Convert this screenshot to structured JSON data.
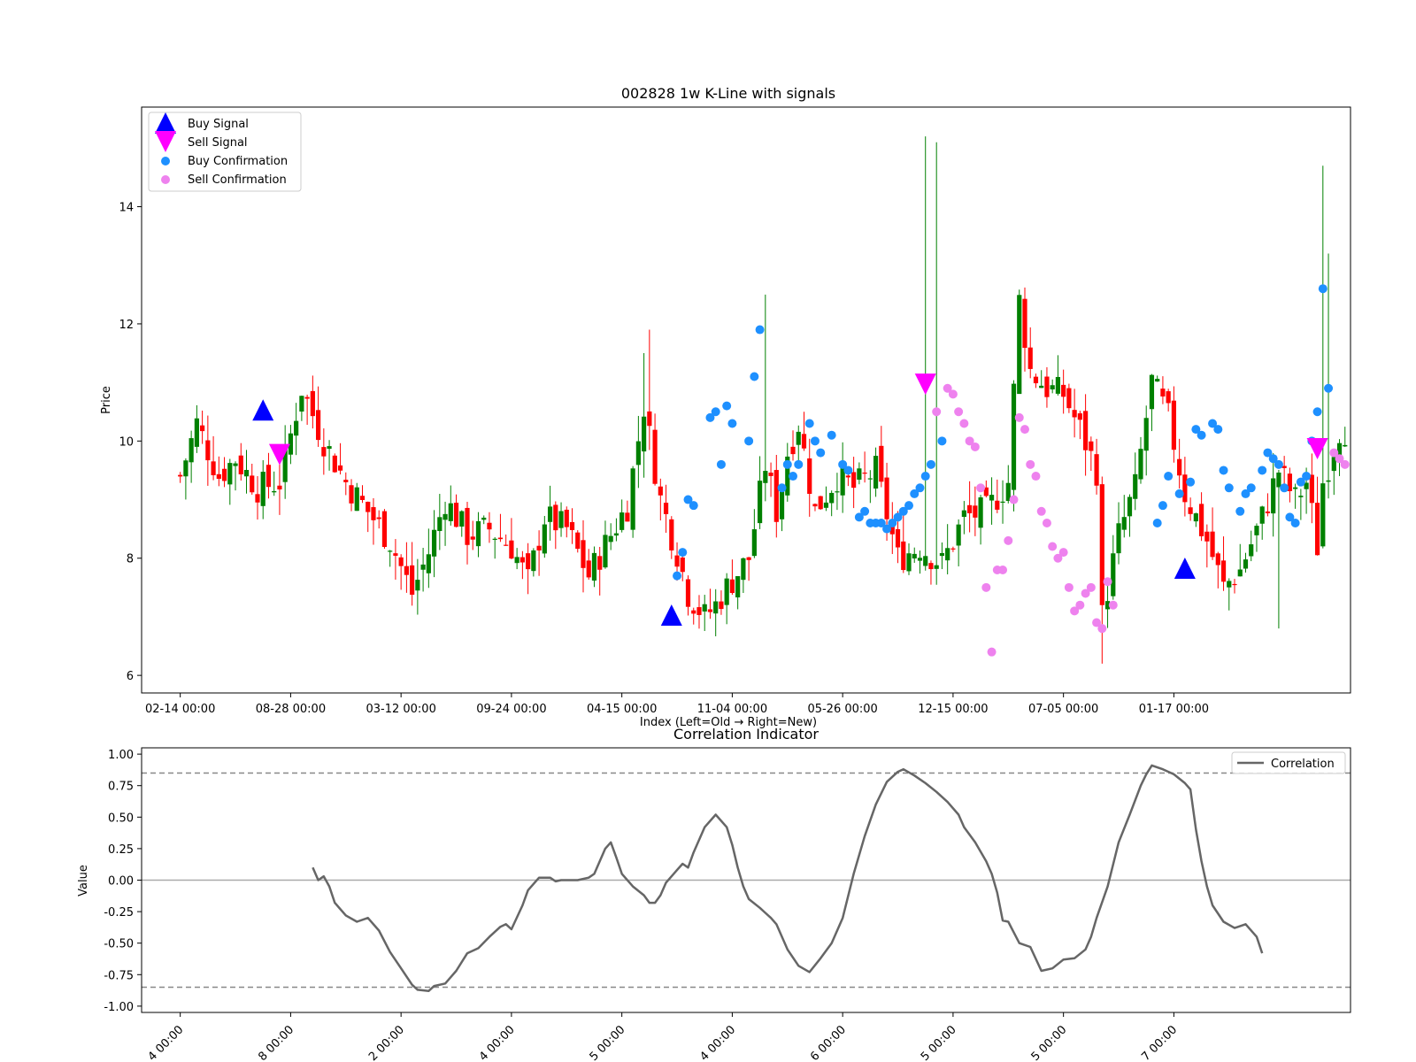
{
  "chart_data": [
    {
      "type": "candlestick",
      "title": "002828 1w K-Line with signals",
      "xlabel": "Index (Left=Old → Right=New)",
      "ylabel": "Price",
      "ylim": [
        5.7,
        15.7
      ],
      "xlim": [
        -7,
        212
      ],
      "yticks": [
        6,
        8,
        10,
        12,
        14
      ],
      "xticks": [
        {
          "i": 0,
          "label": "02-14 00:00"
        },
        {
          "i": 20,
          "label": "08-28 00:00"
        },
        {
          "i": 40,
          "label": "03-12 00:00"
        },
        {
          "i": 60,
          "label": "09-24 00:00"
        },
        {
          "i": 80,
          "label": "04-15 00:00"
        },
        {
          "i": 100,
          "label": "11-04 00:00"
        },
        {
          "i": 120,
          "label": "05-26 00:00"
        },
        {
          "i": 140,
          "label": "12-15 00:00"
        },
        {
          "i": 160,
          "label": "07-05 00:00"
        },
        {
          "i": 180,
          "label": "01-17 00:00"
        }
      ],
      "colors": {
        "up": "#008000",
        "down": "#ff0000",
        "buy_signal": "#0000ff",
        "sell_signal": "#ff00ff",
        "buy_confirmation": "#1e90ff",
        "sell_confirmation": "#ee82ee"
      },
      "legend": {
        "position": "top-left",
        "entries": [
          "Buy Signal",
          "Sell Signal",
          "Buy Confirmation",
          "Sell Confirmation"
        ]
      },
      "close_path": [
        [
          0,
          9.4
        ],
        [
          3,
          10.3
        ],
        [
          7,
          9.4
        ],
        [
          10,
          9.7
        ],
        [
          14,
          9.2
        ],
        [
          18,
          9.3
        ],
        [
          22,
          10.9
        ],
        [
          26,
          10.0
        ],
        [
          30,
          9.3
        ],
        [
          34,
          8.8
        ],
        [
          38,
          8.3
        ],
        [
          42,
          7.4
        ],
        [
          45,
          8.1
        ],
        [
          48,
          9.0
        ],
        [
          52,
          8.4
        ],
        [
          56,
          8.5
        ],
        [
          60,
          8.2
        ],
        [
          63,
          7.6
        ],
        [
          66,
          8.7
        ],
        [
          70,
          8.5
        ],
        [
          74,
          7.7
        ],
        [
          78,
          8.4
        ],
        [
          81,
          8.9
        ],
        [
          84,
          10.6
        ],
        [
          87,
          9.0
        ],
        [
          90,
          8.1
        ],
        [
          92,
          7.4
        ],
        [
          95,
          7.0
        ],
        [
          97,
          7.2
        ],
        [
          99,
          7.5
        ],
        [
          103,
          8.0
        ],
        [
          106,
          9.6
        ],
        [
          108,
          8.8
        ],
        [
          110,
          9.8
        ],
        [
          112,
          10.3
        ],
        [
          115,
          8.8
        ],
        [
          119,
          9.4
        ],
        [
          122,
          9.2
        ],
        [
          126,
          9.5
        ],
        [
          130,
          8.0
        ],
        [
          134,
          8.2
        ],
        [
          138,
          7.9
        ],
        [
          142,
          8.7
        ],
        [
          146,
          8.8
        ],
        [
          150,
          9.3
        ],
        [
          152,
          12.4
        ],
        [
          154,
          11.2
        ],
        [
          157,
          10.9
        ],
        [
          160,
          10.8
        ],
        [
          163,
          10.2
        ],
        [
          166,
          9.5
        ],
        [
          167,
          7.0
        ],
        [
          170,
          8.4
        ],
        [
          173,
          9.2
        ],
        [
          176,
          11.0
        ],
        [
          179,
          10.4
        ],
        [
          182,
          9.1
        ],
        [
          186,
          8.3
        ],
        [
          189,
          7.5
        ],
        [
          192,
          7.8
        ],
        [
          196,
          8.7
        ],
        [
          199,
          9.5
        ],
        [
          202,
          9.0
        ],
        [
          204,
          9.3
        ],
        [
          206,
          8.2
        ],
        [
          207,
          9.3
        ],
        [
          210,
          10.2
        ]
      ],
      "buy_signals": [
        [
          15,
          10.5
        ],
        [
          89,
          7.0
        ],
        [
          182,
          7.8
        ]
      ],
      "sell_signals": [
        [
          18,
          9.8
        ],
        [
          135,
          11.0
        ],
        [
          206,
          9.9
        ]
      ],
      "buy_confirmations": [
        [
          90,
          7.7
        ],
        [
          91,
          8.1
        ],
        [
          92,
          9.0
        ],
        [
          93,
          8.9
        ],
        [
          96,
          10.4
        ],
        [
          97,
          10.5
        ],
        [
          98,
          9.6
        ],
        [
          99,
          10.6
        ],
        [
          100,
          10.3
        ],
        [
          103,
          10.0
        ],
        [
          104,
          11.1
        ],
        [
          105,
          11.9
        ],
        [
          109,
          9.2
        ],
        [
          110,
          9.6
        ],
        [
          111,
          9.4
        ],
        [
          112,
          9.6
        ],
        [
          114,
          10.3
        ],
        [
          115,
          10.0
        ],
        [
          116,
          9.8
        ],
        [
          118,
          10.1
        ],
        [
          120,
          9.6
        ],
        [
          121,
          9.5
        ],
        [
          123,
          8.7
        ],
        [
          124,
          8.8
        ],
        [
          125,
          8.6
        ],
        [
          126,
          8.6
        ],
        [
          127,
          8.6
        ],
        [
          128,
          8.5
        ],
        [
          129,
          8.6
        ],
        [
          130,
          8.7
        ],
        [
          131,
          8.8
        ],
        [
          132,
          8.9
        ],
        [
          133,
          9.1
        ],
        [
          134,
          9.2
        ],
        [
          135,
          9.4
        ],
        [
          136,
          9.6
        ],
        [
          138,
          10.0
        ],
        [
          177,
          8.6
        ],
        [
          178,
          8.9
        ],
        [
          179,
          9.4
        ],
        [
          181,
          9.1
        ],
        [
          183,
          9.3
        ],
        [
          184,
          10.2
        ],
        [
          185,
          10.1
        ],
        [
          187,
          10.3
        ],
        [
          188,
          10.2
        ],
        [
          189,
          9.5
        ],
        [
          190,
          9.2
        ],
        [
          192,
          8.8
        ],
        [
          193,
          9.1
        ],
        [
          194,
          9.2
        ],
        [
          196,
          9.5
        ],
        [
          197,
          9.8
        ],
        [
          198,
          9.7
        ],
        [
          199,
          9.6
        ],
        [
          200,
          9.2
        ],
        [
          201,
          8.7
        ],
        [
          202,
          8.6
        ],
        [
          203,
          9.3
        ],
        [
          204,
          9.4
        ],
        [
          205,
          10.0
        ],
        [
          206,
          10.5
        ],
        [
          207,
          12.6
        ],
        [
          208,
          10.9
        ]
      ],
      "sell_confirmations": [
        [
          137,
          10.5
        ],
        [
          139,
          10.9
        ],
        [
          140,
          10.8
        ],
        [
          141,
          10.5
        ],
        [
          142,
          10.3
        ],
        [
          143,
          10.0
        ],
        [
          144,
          9.9
        ],
        [
          145,
          9.2
        ],
        [
          146,
          7.5
        ],
        [
          147,
          6.4
        ],
        [
          148,
          7.8
        ],
        [
          149,
          7.8
        ],
        [
          150,
          8.3
        ],
        [
          151,
          9.0
        ],
        [
          152,
          10.4
        ],
        [
          153,
          10.2
        ],
        [
          154,
          9.6
        ],
        [
          155,
          9.4
        ],
        [
          156,
          8.8
        ],
        [
          157,
          8.6
        ],
        [
          158,
          8.2
        ],
        [
          159,
          8.0
        ],
        [
          160,
          8.1
        ],
        [
          161,
          7.5
        ],
        [
          162,
          7.1
        ],
        [
          163,
          7.2
        ],
        [
          164,
          7.4
        ],
        [
          165,
          7.5
        ],
        [
          166,
          6.9
        ],
        [
          167,
          6.8
        ],
        [
          168,
          7.6
        ],
        [
          169,
          7.2
        ],
        [
          209,
          9.8
        ],
        [
          210,
          9.7
        ],
        [
          211,
          9.6
        ]
      ]
    },
    {
      "type": "line",
      "title": "Correlation Indicator",
      "xlabel": "",
      "ylabel": "Value",
      "ylim": [
        -1.05,
        1.05
      ],
      "yticks": [
        "1.00",
        "0.75",
        "0.50",
        "0.25",
        "0.00",
        "-0.25",
        "-0.50",
        "-0.75",
        "-1.00"
      ],
      "ytick_values": [
        1.0,
        0.75,
        0.5,
        0.25,
        0.0,
        -0.25,
        -0.5,
        -0.75,
        -1.0
      ],
      "xticks": [
        "4 00:00",
        "8 00:00",
        "2 00:00",
        "4 00:00",
        "5 00:00",
        "4 00:00",
        "6 00:00",
        "5 00:00",
        "5 00:00",
        "7 00:00"
      ],
      "thresholds": [
        0.85,
        -0.85
      ],
      "zero_line": true,
      "legend": {
        "position": "top-right",
        "entries": [
          "Correlation"
        ]
      },
      "series": [
        {
          "name": "Correlation",
          "color": "#666666",
          "points": [
            [
              24,
              0.1
            ],
            [
              25,
              0.0
            ],
            [
              26,
              0.03
            ],
            [
              27,
              -0.05
            ],
            [
              28,
              -0.18
            ],
            [
              30,
              -0.28
            ],
            [
              32,
              -0.33
            ],
            [
              34,
              -0.3
            ],
            [
              36,
              -0.4
            ],
            [
              38,
              -0.57
            ],
            [
              40,
              -0.7
            ],
            [
              42,
              -0.83
            ],
            [
              43,
              -0.87
            ],
            [
              45,
              -0.88
            ],
            [
              46,
              -0.84
            ],
            [
              48,
              -0.82
            ],
            [
              50,
              -0.72
            ],
            [
              52,
              -0.58
            ],
            [
              54,
              -0.54
            ],
            [
              56,
              -0.45
            ],
            [
              58,
              -0.37
            ],
            [
              59,
              -0.35
            ],
            [
              60,
              -0.39
            ],
            [
              62,
              -0.2
            ],
            [
              63,
              -0.08
            ],
            [
              65,
              0.02
            ],
            [
              67,
              0.02
            ],
            [
              68,
              -0.01
            ],
            [
              69,
              0.0
            ],
            [
              72,
              0.0
            ],
            [
              74,
              0.02
            ],
            [
              75,
              0.05
            ],
            [
              76,
              0.15
            ],
            [
              77,
              0.25
            ],
            [
              78,
              0.3
            ],
            [
              79,
              0.18
            ],
            [
              80,
              0.05
            ],
            [
              82,
              -0.05
            ],
            [
              84,
              -0.12
            ],
            [
              85,
              -0.18
            ],
            [
              86,
              -0.18
            ],
            [
              87,
              -0.12
            ],
            [
              88,
              -0.02
            ],
            [
              90,
              0.08
            ],
            [
              91,
              0.13
            ],
            [
              92,
              0.1
            ],
            [
              93,
              0.22
            ],
            [
              95,
              0.42
            ],
            [
              97,
              0.52
            ],
            [
              99,
              0.42
            ],
            [
              100,
              0.28
            ],
            [
              101,
              0.1
            ],
            [
              102,
              -0.05
            ],
            [
              103,
              -0.15
            ],
            [
              105,
              -0.22
            ],
            [
              106,
              -0.26
            ],
            [
              107,
              -0.3
            ],
            [
              108,
              -0.35
            ],
            [
              110,
              -0.55
            ],
            [
              112,
              -0.68
            ],
            [
              114,
              -0.73
            ],
            [
              116,
              -0.62
            ],
            [
              118,
              -0.5
            ],
            [
              120,
              -0.3
            ],
            [
              122,
              0.05
            ],
            [
              124,
              0.35
            ],
            [
              126,
              0.6
            ],
            [
              128,
              0.78
            ],
            [
              130,
              0.86
            ],
            [
              131,
              0.88
            ],
            [
              133,
              0.83
            ],
            [
              135,
              0.77
            ],
            [
              137,
              0.7
            ],
            [
              139,
              0.62
            ],
            [
              141,
              0.52
            ],
            [
              142,
              0.42
            ],
            [
              144,
              0.3
            ],
            [
              146,
              0.15
            ],
            [
              147,
              0.05
            ],
            [
              148,
              -0.1
            ],
            [
              149,
              -0.32
            ],
            [
              150,
              -0.33
            ],
            [
              152,
              -0.5
            ],
            [
              154,
              -0.53
            ],
            [
              156,
              -0.72
            ],
            [
              158,
              -0.7
            ],
            [
              160,
              -0.63
            ],
            [
              162,
              -0.62
            ],
            [
              164,
              -0.55
            ],
            [
              165,
              -0.45
            ],
            [
              166,
              -0.3
            ],
            [
              168,
              -0.05
            ],
            [
              170,
              0.3
            ],
            [
              172,
              0.52
            ],
            [
              174,
              0.75
            ],
            [
              175,
              0.84
            ],
            [
              176,
              0.91
            ],
            [
              178,
              0.88
            ],
            [
              180,
              0.84
            ],
            [
              182,
              0.77
            ],
            [
              183,
              0.72
            ],
            [
              184,
              0.4
            ],
            [
              185,
              0.15
            ],
            [
              186,
              -0.05
            ],
            [
              187,
              -0.2
            ],
            [
              189,
              -0.33
            ],
            [
              191,
              -0.38
            ],
            [
              193,
              -0.35
            ],
            [
              195,
              -0.45
            ],
            [
              196,
              -0.58
            ]
          ]
        }
      ]
    }
  ]
}
